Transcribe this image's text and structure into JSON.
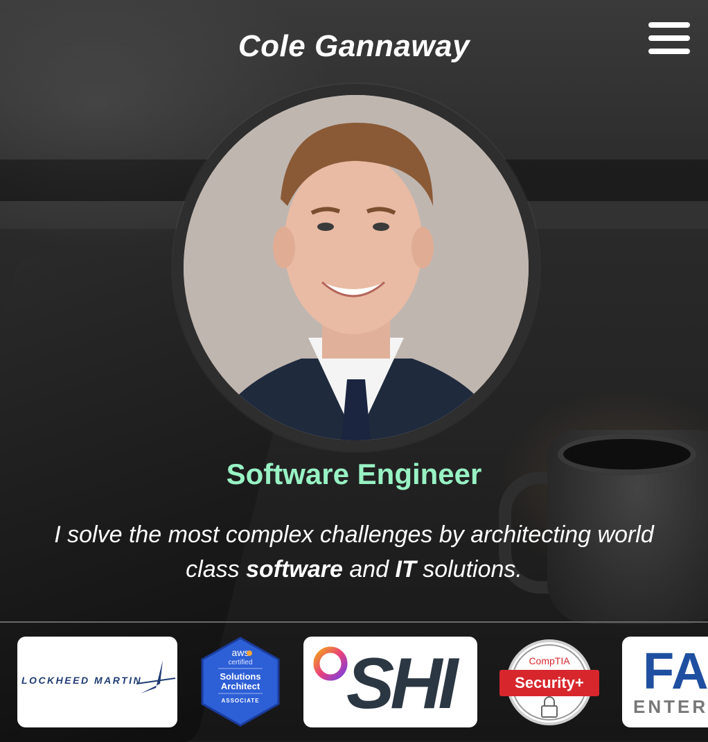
{
  "header": {
    "title": "Cole Gannaway"
  },
  "hero": {
    "role": "Software Engineer",
    "tagline_before": "I solve the most complex challenges by architecting world class",
    "tagline_bold1": "software",
    "tagline_mid": "and",
    "tagline_bold2": "IT",
    "tagline_after": "solutions."
  },
  "logos": {
    "lockheed": "LOCKHEED MARTIN",
    "aws": {
      "line1": "aws",
      "line2": "certified",
      "line3": "Solutions",
      "line4": "Architect",
      "line5": "ASSOCIATE"
    },
    "shi": "SHI",
    "comptia": {
      "top": "CompTIA",
      "banner": "Security+"
    },
    "fa": {
      "top": "FA",
      "bottom": "ENTERP"
    }
  },
  "colors": {
    "accent_green": "#98f2c4",
    "comptia_red": "#d7262c",
    "aws_blue": "#2d5fd6"
  },
  "icons": {
    "menu": "hamburger-menu-icon"
  }
}
